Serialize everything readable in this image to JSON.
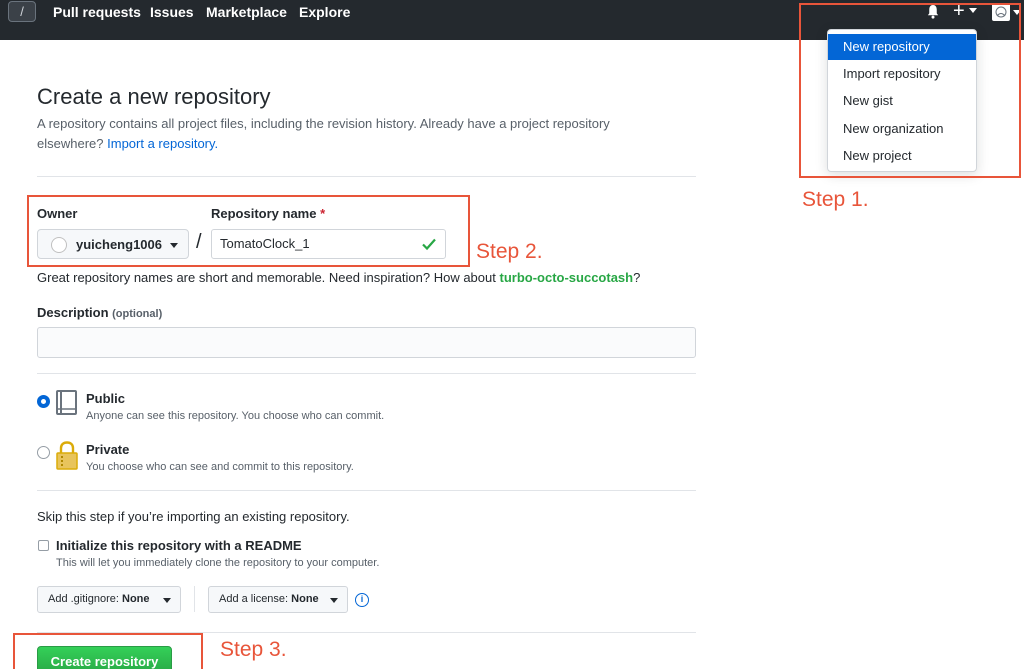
{
  "nav": {
    "links": [
      "Pull requests",
      "Issues",
      "Marketplace",
      "Explore"
    ]
  },
  "dropdown": {
    "items": [
      "New repository",
      "Import repository",
      "New gist",
      "New organization",
      "New project"
    ]
  },
  "annotations": {
    "step1": "Step 1.",
    "step2": "Step 2.",
    "step3": "Step 3.",
    "color": "#e8553a"
  },
  "page": {
    "title": "Create a new repository",
    "subtitle_text": "A repository contains all project files, including the revision history. Already have a project repository elsewhere?",
    "subtitle_link": "Import a repository."
  },
  "form": {
    "owner_label": "Owner",
    "owner_value": "yuicheng1006",
    "repo_label": "Repository name",
    "repo_required": "*",
    "repo_value": "TomatoClock_1",
    "slash": "/",
    "hint_prefix": "Great repository names are short and memorable. Need inspiration? How about",
    "hint_suggestion": "turbo-octo-succotash",
    "hint_suffix": "?",
    "description_label": "Description",
    "description_optional": "(optional)",
    "description_value": ""
  },
  "visibility": {
    "public_title": "Public",
    "public_desc": "Anyone can see this repository. You choose who can commit.",
    "private_title": "Private",
    "private_desc": "You choose who can see and commit to this repository.",
    "selected": "public"
  },
  "init": {
    "skip_text": "Skip this step if you’re importing an existing repository.",
    "readme_label": "Initialize this repository with a README",
    "readme_desc": "This will let you immediately clone the repository to your computer.",
    "gitignore_prefix": "Add .gitignore:",
    "gitignore_value": "None",
    "license_prefix": "Add a license:",
    "license_value": "None",
    "info_symbol": "i"
  },
  "submit": {
    "label": "Create repository"
  },
  "colors": {
    "header_bg": "#24292e",
    "link_blue": "#0366d6",
    "success_green": "#28a745"
  },
  "icons": [
    "github-logo-icon",
    "bell-icon",
    "plus-icon",
    "avatar-icon",
    "checkmark-icon",
    "repo-book-icon",
    "lock-icon",
    "info-icon"
  ]
}
